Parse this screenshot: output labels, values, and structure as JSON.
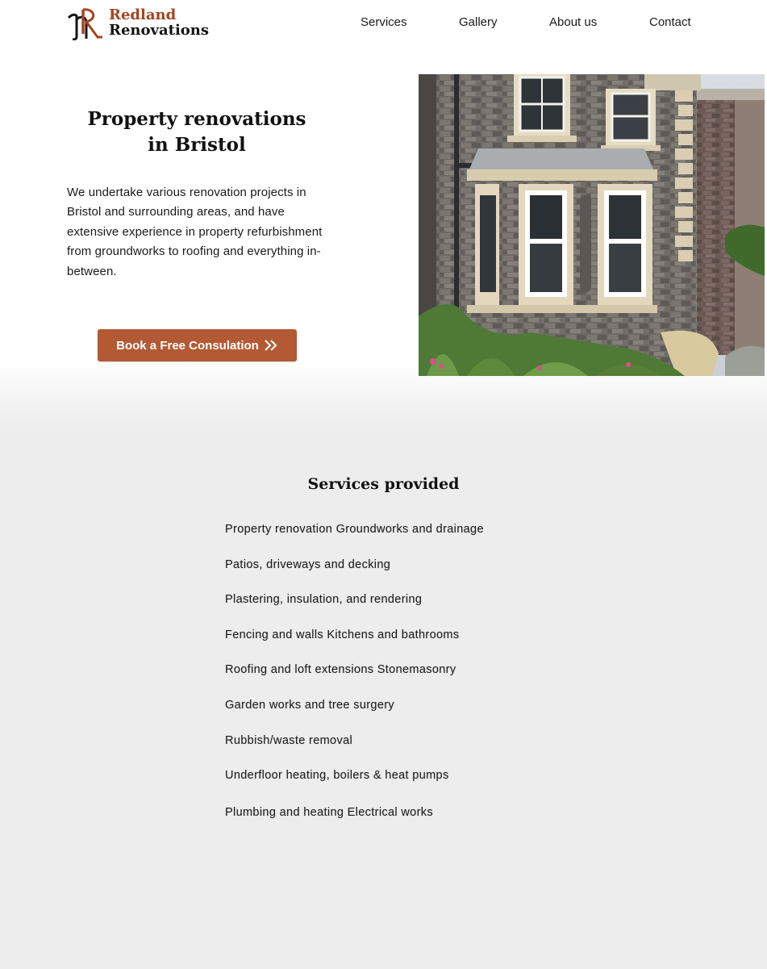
{
  "brand": {
    "name_line1": "Redland",
    "name_line2": "Renovations",
    "colors": {
      "accent": "#a34421",
      "dark": "#141414"
    }
  },
  "nav": {
    "items": [
      {
        "label": "Services"
      },
      {
        "label": "Gallery"
      },
      {
        "label": "About us"
      },
      {
        "label": "Contact"
      }
    ]
  },
  "hero": {
    "title_line1": "Property renovations",
    "title_line2": "in Bristol",
    "description": "We undertake various renovation projects in Bristol and surrounding areas, and have extensive experience in property refurbishment from groundworks to roofing and everything in-between.",
    "cta_label": "Book a Free Consulation",
    "cta_icon": "double-chevron-right-icon",
    "cta_color": "#b35a34",
    "image_subject": "house-photo"
  },
  "services": {
    "title": "Services provided",
    "background": "#ededed",
    "items": [
      "Property renovation Groundworks and drainage",
      "Patios, driveways and decking",
      "Plastering, insulation, and rendering",
      "Fencing and walls Kitchens and bathrooms",
      "Roofing and loft extensions Stonemasonry",
      "Garden works and tree surgery",
      "Rubbish/waste removal",
      "Underfloor heating, boilers & heat pumps",
      "Plumbing and heating Electrical works"
    ]
  }
}
